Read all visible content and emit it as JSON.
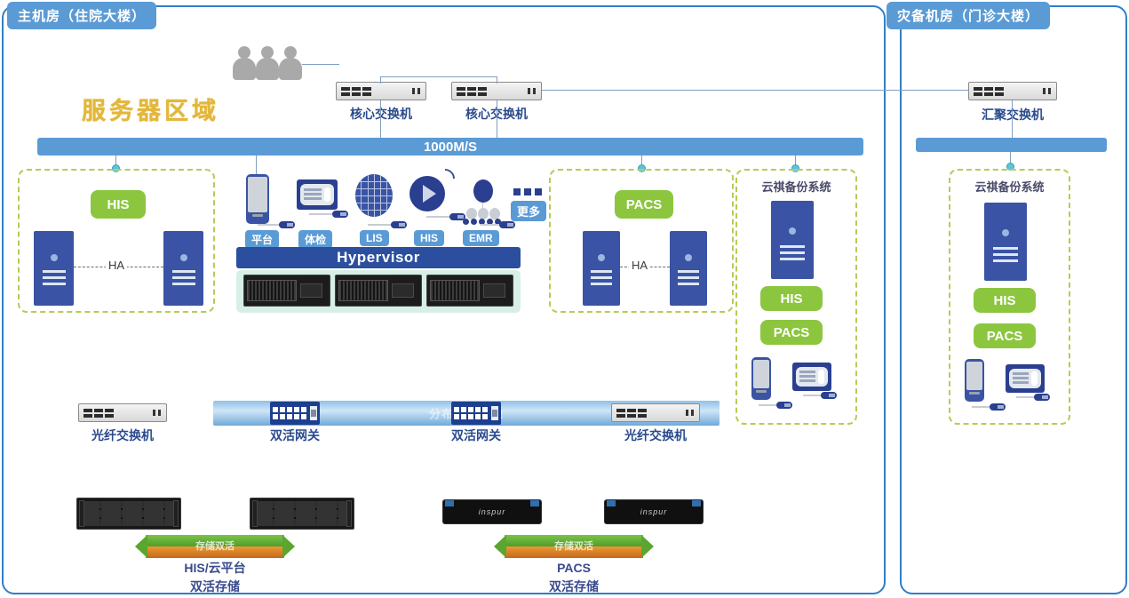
{
  "panels": {
    "main": {
      "tag": "主机房（住院大楼）"
    },
    "dr": {
      "tag": "灾备机房（门诊大楼）"
    }
  },
  "main": {
    "zone_title": "服务器区域",
    "bandwidth_bar": "1000M/S",
    "core_switch_left": "核心交换机",
    "core_switch_right": "核心交换机",
    "hypervisor": "Hypervisor",
    "app_badges": [
      "平台",
      "体检",
      "LIS",
      "HIS",
      "EMR"
    ],
    "more_label": "更多",
    "his_zone": {
      "badge": "HIS",
      "ha": "HA"
    },
    "pacs_zone": {
      "badge": "PACS",
      "ha": "HA"
    },
    "backup_zone": {
      "title": "云祺备份系统",
      "badges": [
        "HIS",
        "PACS"
      ]
    },
    "fabric": {
      "fc_switch_left": "光纤交换机",
      "fc_switch_right": "光纤交换机",
      "gateway_left": "双活网关",
      "gateway_right": "双活网关",
      "pool_label": "分布式共享池"
    },
    "storage_groups": [
      {
        "arrow_label": "存储双活",
        "caption_line1": "HIS/云平台",
        "caption_line2": "双活存储"
      },
      {
        "arrow_label": "存储双活",
        "caption_line1": "PACS",
        "caption_line2": "双活存储"
      }
    ],
    "storage_brand": "inspur"
  },
  "dr": {
    "aggregation_switch": "汇聚交换机",
    "backup_zone": {
      "title": "云祺备份系统",
      "badges": [
        "HIS",
        "PACS"
      ]
    }
  },
  "colors": {
    "panel_border": "#2f7fc7",
    "tag_bg": "#5b9bd5",
    "zone_title": "#e3b73a",
    "bandwidth_bar": "#5b9bd5",
    "dashed_zone": "#b5cc54",
    "green_badge": "#8cc63f",
    "server_blue": "#3a53a4",
    "hypervisor_bar": "#2b4f9e",
    "fiber_link": "#f2c300",
    "arrow_green": "#5aa62f",
    "arrow_orange": "#c8671a",
    "device_label": "#2a4b8d"
  }
}
